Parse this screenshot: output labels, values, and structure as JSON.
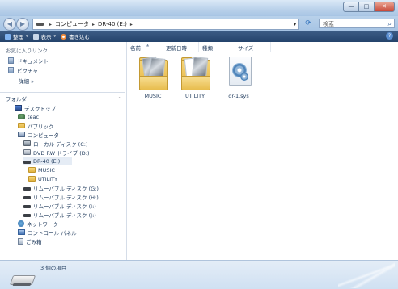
{
  "window": {
    "buttons": {
      "minimize": "—",
      "maximize": "□",
      "close": "✕"
    }
  },
  "address": {
    "path": [
      "コンピュータ",
      "DR-40 (E:)"
    ],
    "search_placeholder": "検索"
  },
  "toolbar": {
    "items": [
      {
        "label": "整理",
        "icon": "organize-icon"
      },
      {
        "label": "表示",
        "icon": "views-icon"
      },
      {
        "label": "書き込む",
        "icon": "burn-icon"
      }
    ]
  },
  "favorites": {
    "title": "お気に入りリンク",
    "items": [
      {
        "label": "ドキュメント"
      },
      {
        "label": "ピクチャ"
      }
    ],
    "more": "詳細 »"
  },
  "folders": {
    "title": "フォルダ",
    "tree": [
      {
        "label": "デスクトップ",
        "icon": "desktop-icon",
        "level": 0
      },
      {
        "label": "teac",
        "icon": "user-icon",
        "level": 1
      },
      {
        "label": "パブリック",
        "icon": "folder-icon",
        "level": 1
      },
      {
        "label": "コンピュータ",
        "icon": "computer-icon",
        "level": 1
      },
      {
        "label": "ローカル ディスク (C:)",
        "icon": "hdd-icon",
        "level": 2
      },
      {
        "label": "DVD RW ドライブ (D:)",
        "icon": "dvd-icon",
        "level": 2
      },
      {
        "label": "DR-40 (E:)",
        "icon": "removable-drive-icon",
        "level": 2
      },
      {
        "label": "MUSIC",
        "icon": "folder-icon",
        "level": 3
      },
      {
        "label": "UTILITY",
        "icon": "folder-icon",
        "level": 3
      },
      {
        "label": "リムーバブル ディスク (G:)",
        "icon": "removable-drive-icon",
        "level": 2
      },
      {
        "label": "リムーバブル ディスク (H:)",
        "icon": "removable-drive-icon",
        "level": 2
      },
      {
        "label": "リムーバブル ディスク (I:)",
        "icon": "removable-drive-icon",
        "level": 2
      },
      {
        "label": "リムーバブル ディスク (J:)",
        "icon": "removable-drive-icon",
        "level": 2
      },
      {
        "label": "ネットワーク",
        "icon": "network-icon",
        "level": 1
      },
      {
        "label": "コントロール パネル",
        "icon": "control-panel-icon",
        "level": 1
      },
      {
        "label": "ごみ箱",
        "icon": "recycle-bin-icon",
        "level": 1
      }
    ]
  },
  "columns": {
    "name": "名前",
    "modified": "更新日時",
    "type": "種類",
    "size": "サイズ"
  },
  "files": [
    {
      "name": "MUSIC",
      "kind": "folder"
    },
    {
      "name": "UTILITY",
      "kind": "folder"
    },
    {
      "name": "dr-1.sys",
      "kind": "system-file"
    }
  ],
  "status": {
    "count": "3 個の項目"
  }
}
